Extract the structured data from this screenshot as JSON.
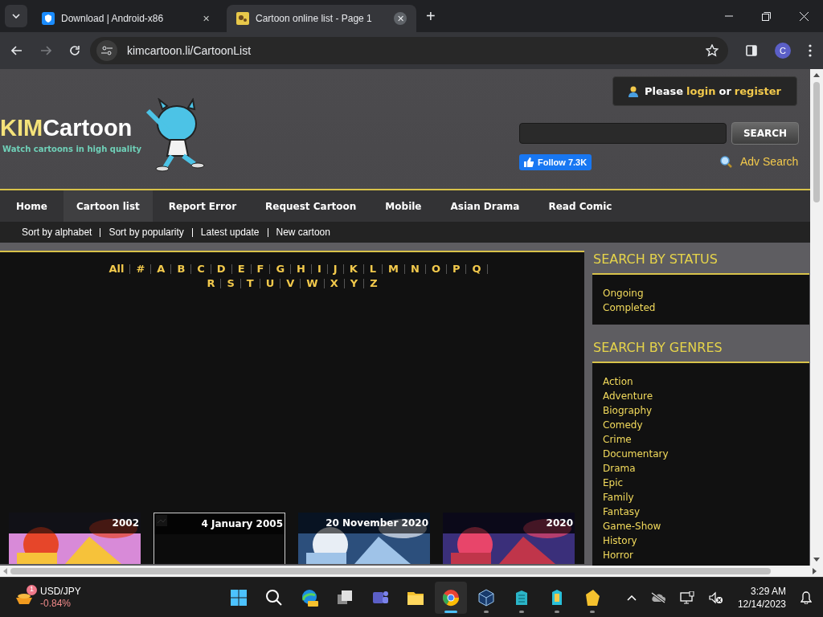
{
  "browser": {
    "tabs": [
      {
        "title": "Download | Android-x86",
        "selected": false,
        "close": "✕"
      },
      {
        "title": "Cartoon online list - Page 1",
        "selected": true,
        "close": "✕"
      }
    ],
    "new_tab": "+",
    "url": "kimcartoon.li/CartoonList",
    "profile": "C"
  },
  "site": {
    "logo": {
      "part1": "KIM",
      "part2": "Cartoon",
      "tagline": "Watch cartoons in high quality"
    },
    "login_box": {
      "prefix": "Please",
      "login": "login",
      "middle": "or",
      "register": "register"
    },
    "search_button": "SEARCH",
    "follow": "Follow 7.3K",
    "adv_search": "Adv Search",
    "nav": [
      {
        "label": "Home",
        "selected": false
      },
      {
        "label": "Cartoon list",
        "selected": true
      },
      {
        "label": "Report Error",
        "selected": false
      },
      {
        "label": "Request Cartoon",
        "selected": false
      },
      {
        "label": "Mobile",
        "selected": false
      },
      {
        "label": "Asian Drama",
        "selected": false
      },
      {
        "label": "Read Comic",
        "selected": false
      }
    ],
    "sub_nav": [
      "Sort by alphabet",
      "Sort by popularity",
      "Latest update",
      "New cartoon"
    ],
    "letter_rows": [
      [
        "All",
        "#",
        "A",
        "B",
        "C",
        "D",
        "E",
        "F",
        "G",
        "H",
        "I",
        "J",
        "K",
        "L",
        "M",
        "N",
        "O",
        "P",
        "Q"
      ],
      [
        "R",
        "S",
        "T",
        "U",
        "V",
        "W",
        "X",
        "Y",
        "Z"
      ]
    ],
    "cards": [
      {
        "kind": "picture",
        "date": "2002"
      },
      {
        "kind": "broken",
        "date": "4 January 2005"
      },
      {
        "kind": "picture",
        "date": "20 November 2020"
      },
      {
        "kind": "picture",
        "date": "2020"
      }
    ],
    "sidebar": [
      {
        "title": "SEARCH BY STATUS",
        "items": [
          "Ongoing",
          "Completed"
        ]
      },
      {
        "title": "SEARCH BY GENRES",
        "items": [
          "Action",
          "Adventure",
          "Biography",
          "Comedy",
          "Crime",
          "Documentary",
          "Drama",
          "Epic",
          "Family",
          "Fantasy",
          "Game-Show",
          "History",
          "Horror"
        ]
      }
    ]
  },
  "taskbar": {
    "ticker": {
      "symbol": "USD/JPY",
      "change": "-0.84%",
      "badge": "1"
    },
    "time": "3:29 AM",
    "date": "12/14/2023"
  }
}
